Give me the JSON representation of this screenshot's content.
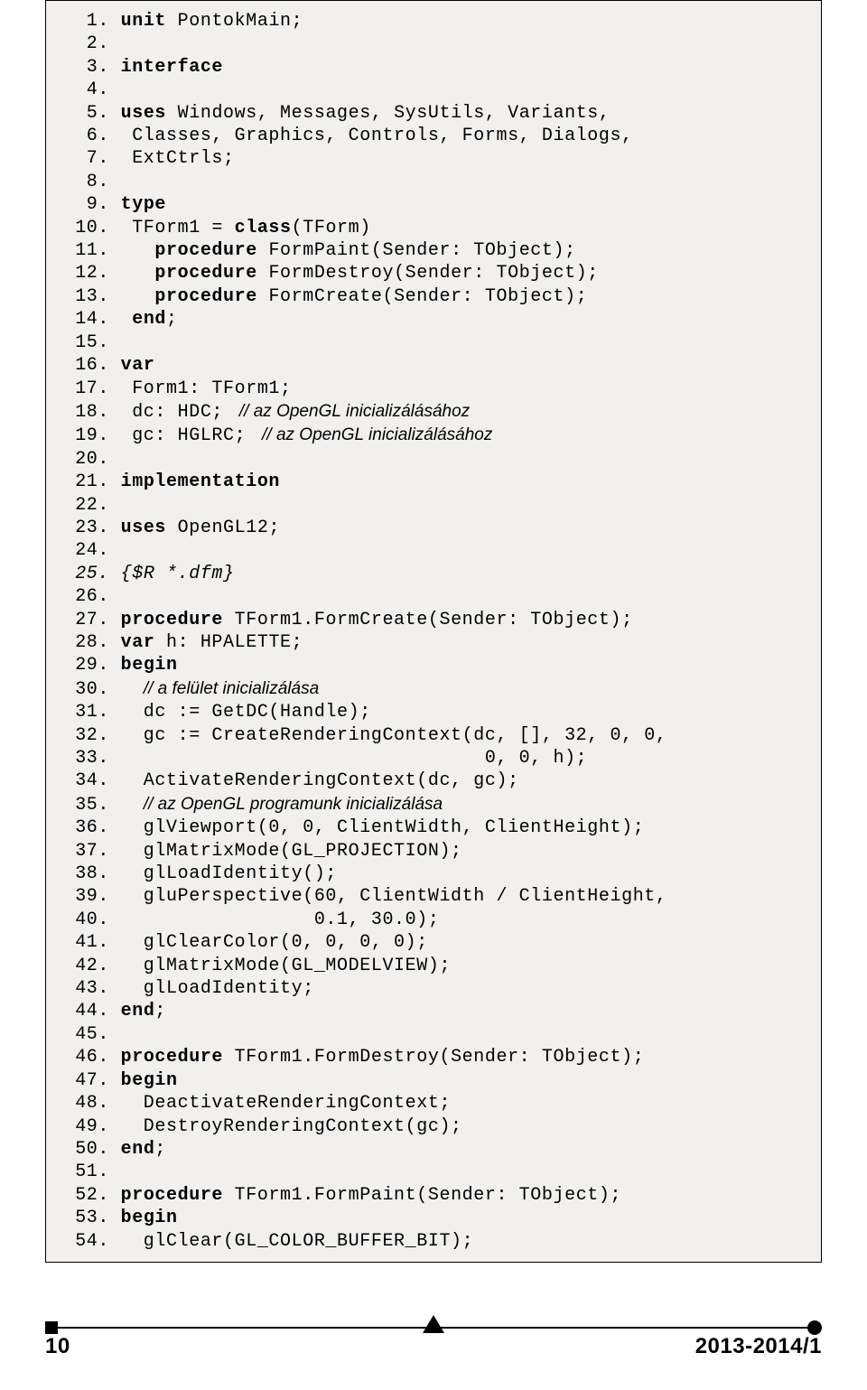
{
  "footer": {
    "page_number": "10",
    "issue": "2013-2014/1"
  },
  "code": {
    "lines": [
      {
        "n": "1.",
        "segments": [
          {
            "t": " ",
            "k": false
          },
          {
            "t": "unit",
            "k": true
          },
          {
            "t": " PontokMain;",
            "k": false
          }
        ]
      },
      {
        "n": "2.",
        "segments": []
      },
      {
        "n": "3.",
        "segments": [
          {
            "t": " ",
            "k": false
          },
          {
            "t": "interface",
            "k": true
          }
        ]
      },
      {
        "n": "4.",
        "segments": []
      },
      {
        "n": "5.",
        "segments": [
          {
            "t": " ",
            "k": false
          },
          {
            "t": "uses",
            "k": true
          },
          {
            "t": " Windows, Messages, SysUtils, Variants,",
            "k": false
          }
        ]
      },
      {
        "n": "6.",
        "segments": [
          {
            "t": "  Classes, Graphics, Controls, Forms, Dialogs,",
            "k": false
          }
        ]
      },
      {
        "n": "7.",
        "segments": [
          {
            "t": "  ExtCtrls;",
            "k": false
          }
        ]
      },
      {
        "n": "8.",
        "segments": []
      },
      {
        "n": "9.",
        "segments": [
          {
            "t": " ",
            "k": false
          },
          {
            "t": "type",
            "k": true
          }
        ]
      },
      {
        "n": "10.",
        "segments": [
          {
            "t": "  TForm1 = ",
            "k": false
          },
          {
            "t": "class",
            "k": true
          },
          {
            "t": "(TForm)",
            "k": false
          }
        ]
      },
      {
        "n": "11.",
        "segments": [
          {
            "t": "    ",
            "k": false
          },
          {
            "t": "procedure",
            "k": true
          },
          {
            "t": " FormPaint(Sender: TObject);",
            "k": false
          }
        ]
      },
      {
        "n": "12.",
        "segments": [
          {
            "t": "    ",
            "k": false
          },
          {
            "t": "procedure",
            "k": true
          },
          {
            "t": " FormDestroy(Sender: TObject);",
            "k": false
          }
        ]
      },
      {
        "n": "13.",
        "segments": [
          {
            "t": "    ",
            "k": false
          },
          {
            "t": "procedure",
            "k": true
          },
          {
            "t": " FormCreate(Sender: TObject);",
            "k": false
          }
        ]
      },
      {
        "n": "14.",
        "segments": [
          {
            "t": "  ",
            "k": false
          },
          {
            "t": "end",
            "k": true
          },
          {
            "t": ";",
            "k": false
          }
        ]
      },
      {
        "n": "15.",
        "segments": []
      },
      {
        "n": "16.",
        "segments": [
          {
            "t": " ",
            "k": false
          },
          {
            "t": "var",
            "k": true
          }
        ]
      },
      {
        "n": "17.",
        "segments": [
          {
            "t": "  Form1: TForm1;",
            "k": false
          }
        ]
      },
      {
        "n": "18.",
        "segments": [
          {
            "t": "  dc: HDC; ",
            "k": false
          },
          {
            "t": " // az OpenGL inicializálásához",
            "c": true
          }
        ]
      },
      {
        "n": "19.",
        "segments": [
          {
            "t": "  gc: HGLRC; ",
            "k": false
          },
          {
            "t": " // az OpenGL inicializálásához",
            "c": true
          }
        ]
      },
      {
        "n": "20.",
        "segments": []
      },
      {
        "n": "21.",
        "segments": [
          {
            "t": " ",
            "k": false
          },
          {
            "t": "implementation",
            "k": true
          }
        ]
      },
      {
        "n": "22.",
        "segments": []
      },
      {
        "n": "23.",
        "segments": [
          {
            "t": " ",
            "k": false
          },
          {
            "t": "uses",
            "k": true
          },
          {
            "t": " OpenGL12;",
            "k": false
          }
        ]
      },
      {
        "n": "24.",
        "segments": []
      },
      {
        "n": "25.",
        "segments": [
          {
            "t": " ",
            "k": false
          },
          {
            "t": "{$R *.dfm}",
            "d": true
          }
        ],
        "italic_line": true
      },
      {
        "n": "26.",
        "segments": []
      },
      {
        "n": "27.",
        "segments": [
          {
            "t": " ",
            "k": false
          },
          {
            "t": "procedure",
            "k": true
          },
          {
            "t": " TForm1.FormCreate(Sender: TObject);",
            "k": false
          }
        ]
      },
      {
        "n": "28.",
        "segments": [
          {
            "t": " ",
            "k": false
          },
          {
            "t": "var",
            "k": true
          },
          {
            "t": " h: HPALETTE;",
            "k": false
          }
        ]
      },
      {
        "n": "29.",
        "segments": [
          {
            "t": " ",
            "k": false
          },
          {
            "t": "begin",
            "k": true
          }
        ]
      },
      {
        "n": "30.",
        "segments": [
          {
            "t": "   ",
            "k": false
          },
          {
            "t": "// a felület inicializálása",
            "c": true
          }
        ]
      },
      {
        "n": "31.",
        "segments": [
          {
            "t": "   dc := GetDC(Handle);",
            "k": false
          }
        ]
      },
      {
        "n": "32.",
        "segments": [
          {
            "t": "   gc := CreateRenderingContext(dc, [], 32, 0, 0,",
            "k": false
          }
        ]
      },
      {
        "n": "33.",
        "segments": [
          {
            "t": "                                 0, 0, h);",
            "k": false
          }
        ]
      },
      {
        "n": "34.",
        "segments": [
          {
            "t": "   ActivateRenderingContext(dc, gc);",
            "k": false
          }
        ]
      },
      {
        "n": "35.",
        "segments": [
          {
            "t": "   ",
            "k": false
          },
          {
            "t": "// az OpenGL programunk inicializálása",
            "c": true
          }
        ]
      },
      {
        "n": "36.",
        "segments": [
          {
            "t": "   glViewport(0, 0, ClientWidth, ClientHeight);",
            "k": false
          }
        ]
      },
      {
        "n": "37.",
        "segments": [
          {
            "t": "   glMatrixMode(GL_PROJECTION);",
            "k": false
          }
        ]
      },
      {
        "n": "38.",
        "segments": [
          {
            "t": "   glLoadIdentity();",
            "k": false
          }
        ]
      },
      {
        "n": "39.",
        "segments": [
          {
            "t": "   gluPerspective(60, ClientWidth / ClientHeight,",
            "k": false
          }
        ]
      },
      {
        "n": "40.",
        "segments": [
          {
            "t": "                  0.1, 30.0);",
            "k": false
          }
        ]
      },
      {
        "n": "41.",
        "segments": [
          {
            "t": "   glClearColor(0, 0, 0, 0);",
            "k": false
          }
        ]
      },
      {
        "n": "42.",
        "segments": [
          {
            "t": "   glMatrixMode(GL_MODELVIEW);",
            "k": false
          }
        ]
      },
      {
        "n": "43.",
        "segments": [
          {
            "t": "   glLoadIdentity;",
            "k": false
          }
        ]
      },
      {
        "n": "44.",
        "segments": [
          {
            "t": " ",
            "k": false
          },
          {
            "t": "end",
            "k": true
          },
          {
            "t": ";",
            "k": false
          }
        ]
      },
      {
        "n": "45.",
        "segments": []
      },
      {
        "n": "46.",
        "segments": [
          {
            "t": " ",
            "k": false
          },
          {
            "t": "procedure",
            "k": true
          },
          {
            "t": " TForm1.FormDestroy(Sender: TObject);",
            "k": false
          }
        ]
      },
      {
        "n": "47.",
        "segments": [
          {
            "t": " ",
            "k": false
          },
          {
            "t": "begin",
            "k": true
          }
        ]
      },
      {
        "n": "48.",
        "segments": [
          {
            "t": "   DeactivateRenderingContext;",
            "k": false
          }
        ]
      },
      {
        "n": "49.",
        "segments": [
          {
            "t": "   DestroyRenderingContext(gc);",
            "k": false
          }
        ]
      },
      {
        "n": "50.",
        "segments": [
          {
            "t": " ",
            "k": false
          },
          {
            "t": "end",
            "k": true
          },
          {
            "t": ";",
            "k": false
          }
        ]
      },
      {
        "n": "51.",
        "segments": []
      },
      {
        "n": "52.",
        "segments": [
          {
            "t": " ",
            "k": false
          },
          {
            "t": "procedure",
            "k": true
          },
          {
            "t": " TForm1.FormPaint(Sender: TObject);",
            "k": false
          }
        ]
      },
      {
        "n": "53.",
        "segments": [
          {
            "t": " ",
            "k": false
          },
          {
            "t": "begin",
            "k": true
          }
        ]
      },
      {
        "n": "54.",
        "segments": [
          {
            "t": "   glClear(GL_COLOR_BUFFER_BIT);",
            "k": false
          }
        ]
      }
    ]
  }
}
